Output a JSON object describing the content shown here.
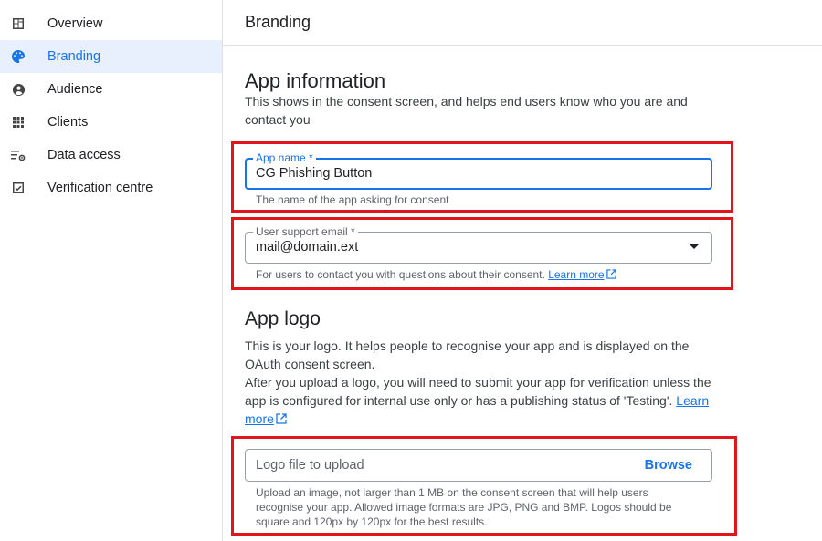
{
  "sidebar": {
    "items": [
      {
        "label": "Overview",
        "icon": "dashboard-icon"
      },
      {
        "label": "Branding",
        "icon": "palette-icon",
        "active": true
      },
      {
        "label": "Audience",
        "icon": "person-icon"
      },
      {
        "label": "Clients",
        "icon": "apps-grid-icon"
      },
      {
        "label": "Data access",
        "icon": "data-access-icon"
      },
      {
        "label": "Verification centre",
        "icon": "checkbox-icon"
      }
    ]
  },
  "header": {
    "title": "Branding"
  },
  "app_info": {
    "heading": "App information",
    "description": "This shows in the consent screen, and helps end users know who you are and contact you",
    "app_name": {
      "label": "App name *",
      "value": "CG Phishing Button",
      "hint": "The name of the app asking for consent"
    },
    "support_email": {
      "label": "User support email *",
      "value": "mail@domain.ext",
      "hint": "For users to contact you with questions about their consent.",
      "learn_more": "Learn more"
    }
  },
  "app_logo": {
    "heading": "App logo",
    "desc1": "This is your logo. It helps people to recognise your app and is displayed on the OAuth consent screen.",
    "desc2": "After you upload a logo, you will need to submit your app for verification unless the app is configured for internal use only or has a publishing status of 'Testing'.",
    "learn_more": "Learn more",
    "upload_placeholder": "Logo file to upload",
    "browse": "Browse",
    "upload_hint": "Upload an image, not larger than 1 MB on the consent screen that will help users recognise your app. Allowed image formats are JPG, PNG and BMP. Logos should be square and 120px by 120px for the best results."
  },
  "colors": {
    "accent": "#1a73e8",
    "highlight": "#e0161c",
    "active_bg": "#e8f0fe"
  }
}
